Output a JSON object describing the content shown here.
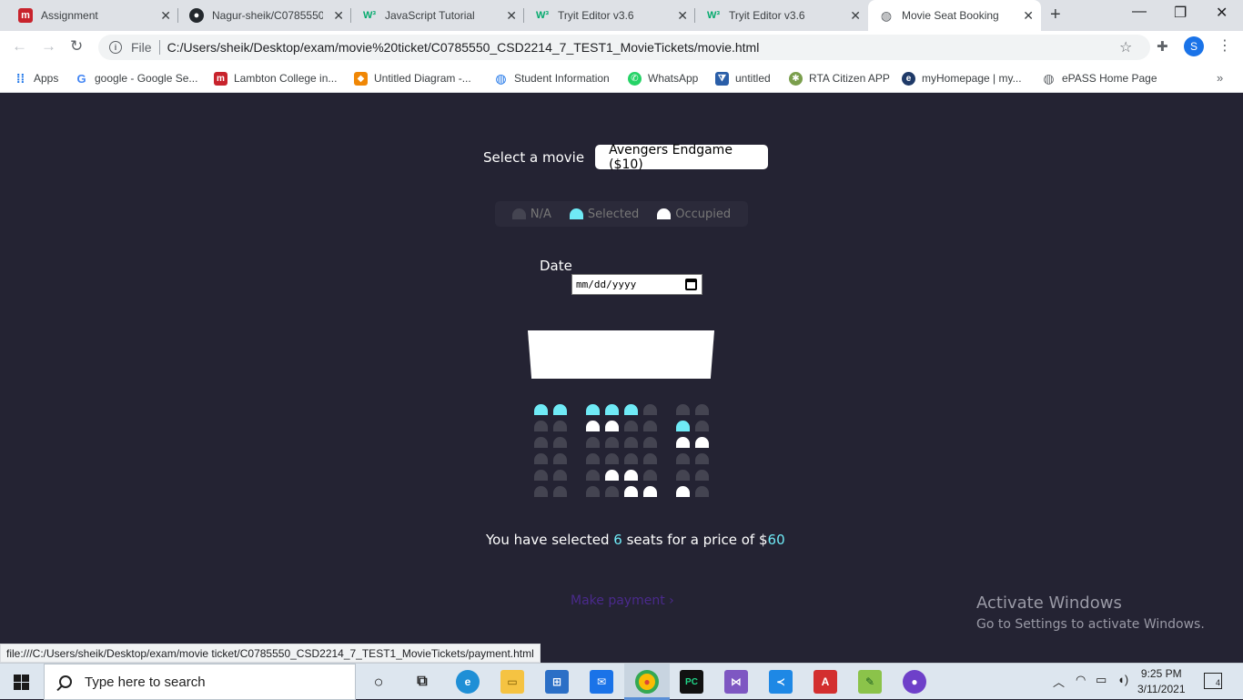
{
  "browser": {
    "tabs": [
      {
        "label": "Assignment",
        "icon": "m-logo-icon"
      },
      {
        "label": "Nagur-sheik/C0785550",
        "icon": "github-icon"
      },
      {
        "label": "JavaScript Tutorial",
        "icon": "w3schools-icon"
      },
      {
        "label": "Tryit Editor v3.6",
        "icon": "w3schools-icon"
      },
      {
        "label": "Tryit Editor v3.6",
        "icon": "w3schools-icon"
      },
      {
        "label": "Movie Seat Booking",
        "icon": "globe-icon",
        "active": true
      }
    ],
    "new_tab_symbol": "+",
    "window_controls": {
      "minimize": "—",
      "restore": "❐",
      "close": "✕"
    },
    "address": {
      "scheme_label": "File",
      "url": "C:/Users/sheik/Desktop/exam/movie%20ticket/C0785550_CSD2214_7_TEST1_MovieTickets/movie.html"
    },
    "profile_initial": "S",
    "bookmarks": [
      {
        "label": "Apps",
        "icon": "apps-grid-icon"
      },
      {
        "label": "google - Google Se...",
        "icon": "google-icon"
      },
      {
        "label": "Lambton College in...",
        "icon": "m-logo-icon"
      },
      {
        "label": "Untitled Diagram -...",
        "icon": "drawio-icon"
      },
      {
        "label": "Student Information",
        "icon": "globe-icon"
      },
      {
        "label": "WhatsApp",
        "icon": "whatsapp-icon"
      },
      {
        "label": "untitled",
        "icon": "vscode-icon"
      },
      {
        "label": "RTA Citizen APP",
        "icon": "emblem-icon"
      },
      {
        "label": "myHomepage | my...",
        "icon": "circle-e-icon"
      },
      {
        "label": "ePASS Home Page",
        "icon": "globe-icon"
      }
    ],
    "bookmarks_more": "»",
    "status_url": "file:///C:/Users/sheik/Desktop/exam/movie ticket/C0785550_CSD2214_7_TEST1_MovieTickets/payment.html"
  },
  "page": {
    "movie_label": "Select a movie",
    "movie_selected": "Avengers Endgame ($10)",
    "legend": [
      {
        "label": "N/A",
        "state": "na"
      },
      {
        "label": "Selected",
        "state": "selected"
      },
      {
        "label": "Occupied",
        "state": "occupied"
      }
    ],
    "date_label": "Date",
    "date_placeholder": "mm/dd/yyyy",
    "seat_rows": [
      [
        "s",
        "s",
        "s",
        "s",
        "s",
        "n",
        "n",
        "n"
      ],
      [
        "n",
        "n",
        "o",
        "o",
        "n",
        "n",
        "s",
        "n"
      ],
      [
        "n",
        "n",
        "n",
        "n",
        "n",
        "n",
        "o",
        "o"
      ],
      [
        "n",
        "n",
        "n",
        "n",
        "n",
        "n",
        "n",
        "n"
      ],
      [
        "n",
        "n",
        "n",
        "o",
        "o",
        "n",
        "n",
        "n"
      ],
      [
        "n",
        "n",
        "n",
        "n",
        "o",
        "o",
        "o",
        "n"
      ]
    ],
    "summary": {
      "prefix": "You have selected ",
      "count": "6",
      "middle": " seats for a price of $",
      "total": "60"
    },
    "payment_link": "Make payment ›"
  },
  "watermark": {
    "line1": "Activate Windows",
    "line2": "Go to Settings to activate Windows."
  },
  "taskbar": {
    "search_placeholder": "Type here to search",
    "apps": [
      "cortana-icon",
      "task-view-icon",
      "edge-icon",
      "file-explorer-icon",
      "store-icon",
      "mail-icon",
      "chrome-icon",
      "pycharm-icon",
      "visual-studio-icon",
      "vscode-icon",
      "acrobat-icon",
      "notepad-plus-icon",
      "github-desktop-icon"
    ],
    "time": "9:25 PM",
    "date": "3/11/2021",
    "notification_count": "4"
  },
  "colors": {
    "page_bg": "#242333",
    "seat_na": "#444451",
    "seat_selected": "#6feaf6",
    "seat_occupied": "#ffffff"
  }
}
